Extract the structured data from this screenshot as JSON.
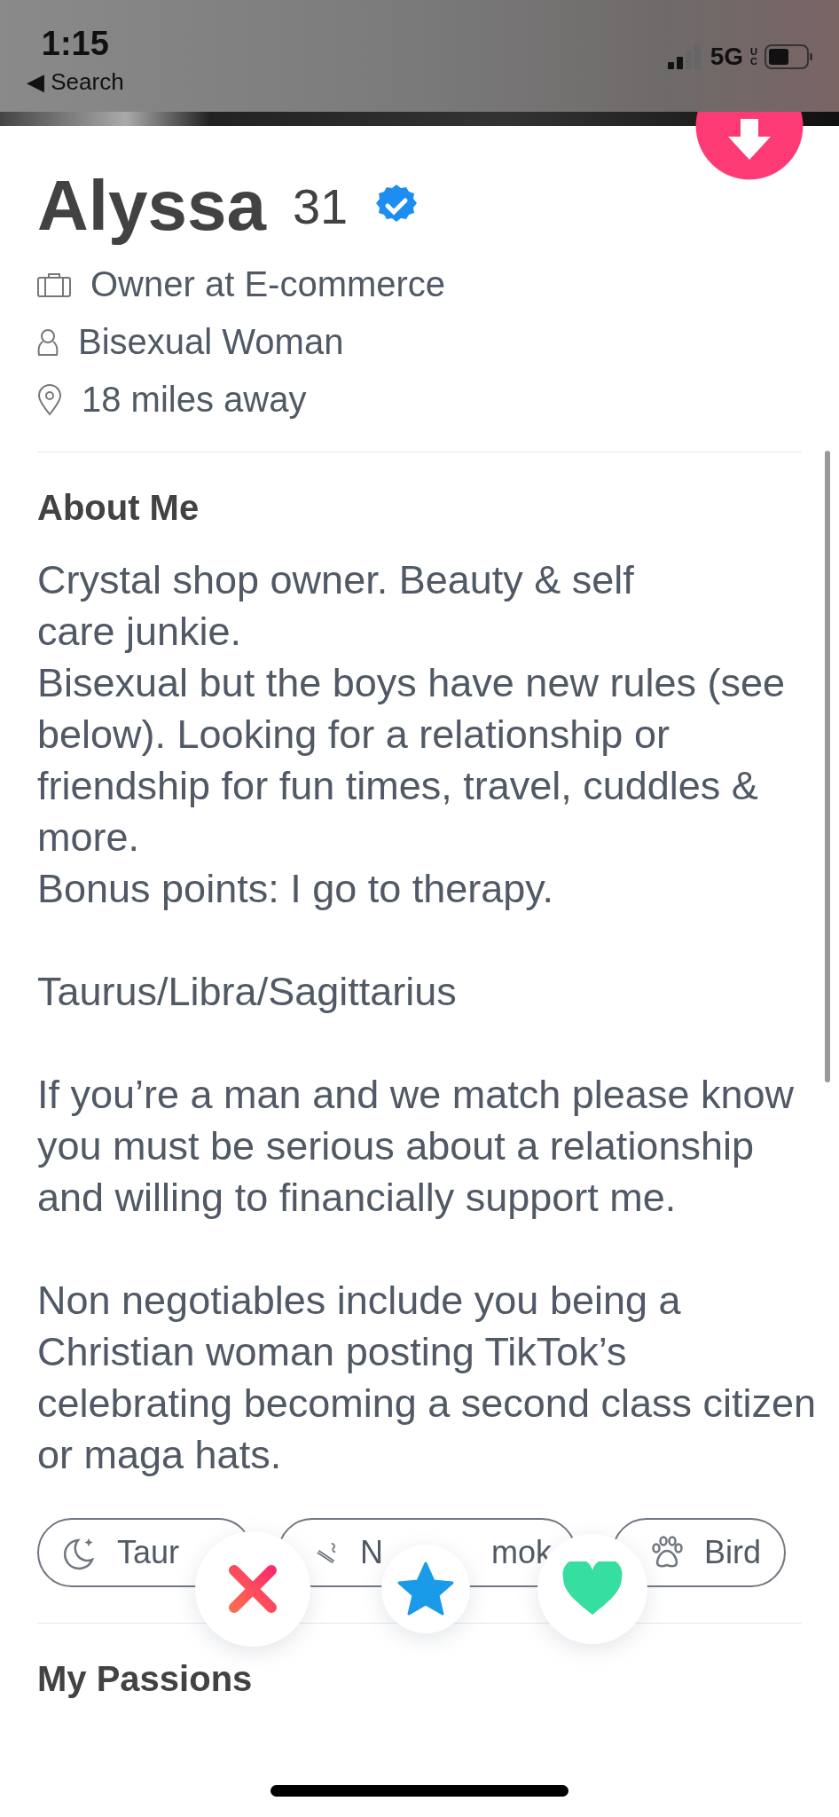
{
  "status_bar": {
    "time": "1:15",
    "back": "◀ Search",
    "network": "5G",
    "network_sub": "UC"
  },
  "profile": {
    "name": "Alyssa",
    "age": "31",
    "verified": true,
    "details": [
      {
        "kind": "job",
        "text": "Owner at E-commerce"
      },
      {
        "kind": "gender",
        "text": "Bisexual Woman"
      },
      {
        "kind": "distance",
        "text": "18 miles away"
      }
    ]
  },
  "about": {
    "heading": "About Me",
    "paragraphs": [
      "Crystal shop owner. Beauty & self\ncare junkie.\nBisexual but the boys have new rules (see below). Looking for a relationship or friendship for fun times, travel, cuddles & more.\nBonus points: I go to therapy.",
      "Taurus/Libra/Sagittarius",
      "If you’re a man and we match please know you must be serious about a relationship and willing to financially support me.",
      "Non negotiables include you being a Christian woman posting TikTok’s celebrating becoming a second class citizen or maga hats."
    ]
  },
  "chips": [
    {
      "kind": "zodiac",
      "parts": [
        "Taur"
      ]
    },
    {
      "kind": "smoking",
      "parts": [
        "N",
        "mok"
      ]
    },
    {
      "kind": "pets",
      "parts": [
        "Bird"
      ]
    }
  ],
  "actions": [
    {
      "kind": "nope"
    },
    {
      "kind": "super"
    },
    {
      "kind": "like"
    }
  ],
  "passions": {
    "heading": "My Passions"
  }
}
